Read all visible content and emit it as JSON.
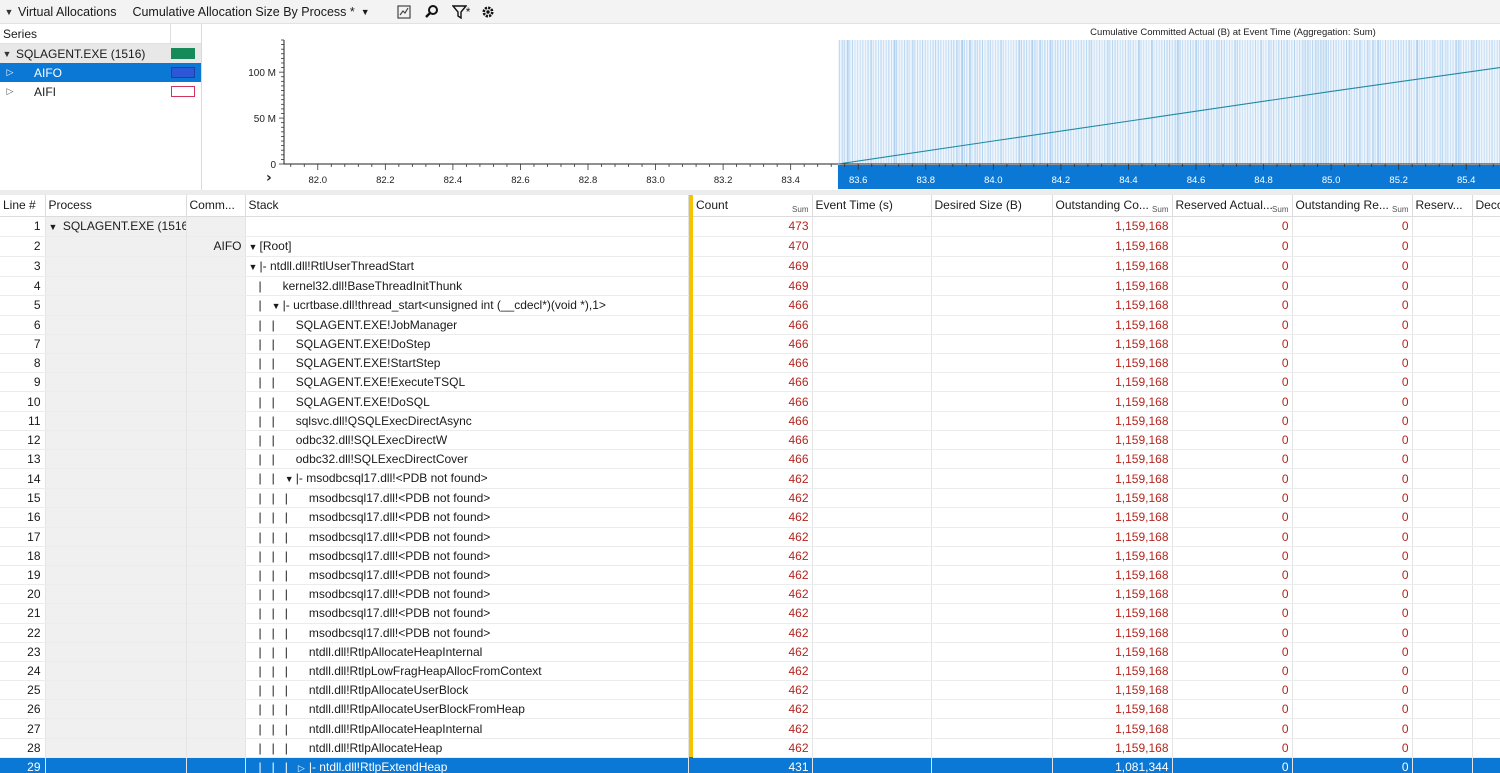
{
  "toolbar": {
    "title": "Virtual Allocations",
    "view_label": "Cumulative Allocation Size By Process *",
    "filter_label": "*"
  },
  "series": {
    "header": "Series",
    "items": [
      {
        "label": "SQLAGENT.EXE (1516)",
        "swatch": "#178a5a",
        "kind": "group",
        "expanded": true
      },
      {
        "label": "AIFO",
        "swatch": "#2c57d6",
        "kind": "child",
        "selected": true
      },
      {
        "label": "AIFI",
        "swatch": "#ffffff",
        "swatch_border": "#d0345a",
        "kind": "child",
        "selected": false
      }
    ]
  },
  "chart_data": {
    "type": "line",
    "title": "Cumulative Committed Actual (B) at Event Time (Aggregation: Sum)",
    "xlim": [
      81.9,
      85.5
    ],
    "ylim": [
      0,
      135
    ],
    "x_ticks": [
      "82.0",
      "82.2",
      "82.4",
      "82.6",
      "82.8",
      "83.0",
      "83.2",
      "83.4",
      "83.6",
      "83.8",
      "84.0",
      "84.2",
      "84.4",
      "84.6",
      "84.8",
      "85.0",
      "85.2",
      "85.4"
    ],
    "x_tick_values": [
      82.0,
      82.2,
      82.4,
      82.6,
      82.8,
      83.0,
      83.2,
      83.4,
      83.6,
      83.8,
      84.0,
      84.2,
      84.4,
      84.6,
      84.8,
      85.0,
      85.2,
      85.4
    ],
    "y_ticks": [
      "0",
      "50 M",
      "100 M"
    ],
    "y_tick_values": [
      0,
      50,
      100
    ],
    "selection_range": [
      83.54,
      85.5
    ],
    "series": [
      {
        "x": [
          83.54,
          84.0,
          84.5,
          85.0,
          85.5
        ],
        "y": [
          0,
          25,
          52,
          79,
          105
        ]
      }
    ],
    "colors": {
      "line": "#1e8aa0",
      "selection": "#0a78d4",
      "event_ticks": "#a8cdee"
    }
  },
  "table": {
    "columns": [
      {
        "label": "Line #"
      },
      {
        "label": "Process"
      },
      {
        "label": "Comm..."
      },
      {
        "label": "Stack"
      },
      {
        "label": "Count",
        "sum": "Sum"
      },
      {
        "label": "Event Time (s)"
      },
      {
        "label": "Desired Size (B)"
      },
      {
        "label": "Outstanding Co...",
        "sum": "Sum"
      },
      {
        "label": "Reserved Actual...",
        "sum": "Sum"
      },
      {
        "label": "Outstanding Re...",
        "sum": "Sum"
      },
      {
        "label": "Reserv..."
      },
      {
        "label": "Deco"
      }
    ],
    "rows": [
      {
        "line": "1",
        "process": "SQLAGENT.EXE (1516)",
        "proc_tri": "▼",
        "comm": "",
        "stack": "",
        "stack_tri": "",
        "pipes": "",
        "count": "473",
        "oc": "1,159,168",
        "ra": "0",
        "or": "0"
      },
      {
        "line": "2",
        "process": "",
        "comm": "AIFO",
        "stack": "[Root]",
        "stack_tri": "▼",
        "pipes": "",
        "count": "470",
        "oc": "1,159,168",
        "ra": "0",
        "or": "0"
      },
      {
        "line": "3",
        "process": "",
        "comm": "",
        "stack": "|- ntdll.dll!RtlUserThreadStart",
        "stack_tri": "▼",
        "pipes": "",
        "count": "469",
        "oc": "1,159,168",
        "ra": "0",
        "or": "0"
      },
      {
        "line": "4",
        "process": "",
        "comm": "",
        "stack": "kernel32.dll!BaseThreadInitThunk",
        "stack_tri": "",
        "pipes": "   |   ",
        "count": "469",
        "oc": "1,159,168",
        "ra": "0",
        "or": "0"
      },
      {
        "line": "5",
        "process": "",
        "comm": "",
        "stack": "|- ucrtbase.dll!thread_start<unsigned int (__cdecl*)(void *),1>",
        "stack_tri": "▼",
        "pipes": "   |   ",
        "count": "466",
        "oc": "1,159,168",
        "ra": "0",
        "or": "0"
      },
      {
        "line": "6",
        "process": "",
        "comm": "",
        "stack": "SQLAGENT.EXE!JobManager",
        "stack_tri": "",
        "pipes": "   |   |   ",
        "count": "466",
        "oc": "1,159,168",
        "ra": "0",
        "or": "0"
      },
      {
        "line": "7",
        "process": "",
        "comm": "",
        "stack": "SQLAGENT.EXE!DoStep",
        "stack_tri": "",
        "pipes": "   |   |   ",
        "count": "466",
        "oc": "1,159,168",
        "ra": "0",
        "or": "0"
      },
      {
        "line": "8",
        "process": "",
        "comm": "",
        "stack": "SQLAGENT.EXE!StartStep",
        "stack_tri": "",
        "pipes": "   |   |   ",
        "count": "466",
        "oc": "1,159,168",
        "ra": "0",
        "or": "0"
      },
      {
        "line": "9",
        "process": "",
        "comm": "",
        "stack": "SQLAGENT.EXE!ExecuteTSQL",
        "stack_tri": "",
        "pipes": "   |   |   ",
        "count": "466",
        "oc": "1,159,168",
        "ra": "0",
        "or": "0"
      },
      {
        "line": "10",
        "process": "",
        "comm": "",
        "stack": "SQLAGENT.EXE!DoSQL",
        "stack_tri": "",
        "pipes": "   |   |   ",
        "count": "466",
        "oc": "1,159,168",
        "ra": "0",
        "or": "0"
      },
      {
        "line": "11",
        "process": "",
        "comm": "",
        "stack": "sqlsvc.dll!QSQLExecDirectAsync",
        "stack_tri": "",
        "pipes": "   |   |   ",
        "count": "466",
        "oc": "1,159,168",
        "ra": "0",
        "or": "0"
      },
      {
        "line": "12",
        "process": "",
        "comm": "",
        "stack": "odbc32.dll!SQLExecDirectW",
        "stack_tri": "",
        "pipes": "   |   |   ",
        "count": "466",
        "oc": "1,159,168",
        "ra": "0",
        "or": "0"
      },
      {
        "line": "13",
        "process": "",
        "comm": "",
        "stack": "odbc32.dll!SQLExecDirectCover",
        "stack_tri": "",
        "pipes": "   |   |   ",
        "count": "466",
        "oc": "1,159,168",
        "ra": "0",
        "or": "0"
      },
      {
        "line": "14",
        "process": "",
        "comm": "",
        "stack": "|- msodbcsql17.dll!<PDB not found>",
        "stack_tri": "▼",
        "pipes": "   |   |   ",
        "count": "462",
        "oc": "1,159,168",
        "ra": "0",
        "or": "0"
      },
      {
        "line": "15",
        "process": "",
        "comm": "",
        "stack": "msodbcsql17.dll!<PDB not found>",
        "stack_tri": "",
        "pipes": "   |   |   |   ",
        "count": "462",
        "oc": "1,159,168",
        "ra": "0",
        "or": "0"
      },
      {
        "line": "16",
        "process": "",
        "comm": "",
        "stack": "msodbcsql17.dll!<PDB not found>",
        "stack_tri": "",
        "pipes": "   |   |   |   ",
        "count": "462",
        "oc": "1,159,168",
        "ra": "0",
        "or": "0"
      },
      {
        "line": "17",
        "process": "",
        "comm": "",
        "stack": "msodbcsql17.dll!<PDB not found>",
        "stack_tri": "",
        "pipes": "   |   |   |   ",
        "count": "462",
        "oc": "1,159,168",
        "ra": "0",
        "or": "0"
      },
      {
        "line": "18",
        "process": "",
        "comm": "",
        "stack": "msodbcsql17.dll!<PDB not found>",
        "stack_tri": "",
        "pipes": "   |   |   |   ",
        "count": "462",
        "oc": "1,159,168",
        "ra": "0",
        "or": "0"
      },
      {
        "line": "19",
        "process": "",
        "comm": "",
        "stack": "msodbcsql17.dll!<PDB not found>",
        "stack_tri": "",
        "pipes": "   |   |   |   ",
        "count": "462",
        "oc": "1,159,168",
        "ra": "0",
        "or": "0"
      },
      {
        "line": "20",
        "process": "",
        "comm": "",
        "stack": "msodbcsql17.dll!<PDB not found>",
        "stack_tri": "",
        "pipes": "   |   |   |   ",
        "count": "462",
        "oc": "1,159,168",
        "ra": "0",
        "or": "0"
      },
      {
        "line": "21",
        "process": "",
        "comm": "",
        "stack": "msodbcsql17.dll!<PDB not found>",
        "stack_tri": "",
        "pipes": "   |   |   |   ",
        "count": "462",
        "oc": "1,159,168",
        "ra": "0",
        "or": "0"
      },
      {
        "line": "22",
        "process": "",
        "comm": "",
        "stack": "msodbcsql17.dll!<PDB not found>",
        "stack_tri": "",
        "pipes": "   |   |   |   ",
        "count": "462",
        "oc": "1,159,168",
        "ra": "0",
        "or": "0"
      },
      {
        "line": "23",
        "process": "",
        "comm": "",
        "stack": "ntdll.dll!RtlpAllocateHeapInternal",
        "stack_tri": "",
        "pipes": "   |   |   |   ",
        "count": "462",
        "oc": "1,159,168",
        "ra": "0",
        "or": "0"
      },
      {
        "line": "24",
        "process": "",
        "comm": "",
        "stack": "ntdll.dll!RtlpLowFragHeapAllocFromContext",
        "stack_tri": "",
        "pipes": "   |   |   |   ",
        "count": "462",
        "oc": "1,159,168",
        "ra": "0",
        "or": "0"
      },
      {
        "line": "25",
        "process": "",
        "comm": "",
        "stack": "ntdll.dll!RtlpAllocateUserBlock",
        "stack_tri": "",
        "pipes": "   |   |   |   ",
        "count": "462",
        "oc": "1,159,168",
        "ra": "0",
        "or": "0"
      },
      {
        "line": "26",
        "process": "",
        "comm": "",
        "stack": "ntdll.dll!RtlpAllocateUserBlockFromHeap",
        "stack_tri": "",
        "pipes": "   |   |   |   ",
        "count": "462",
        "oc": "1,159,168",
        "ra": "0",
        "or": "0"
      },
      {
        "line": "27",
        "process": "",
        "comm": "",
        "stack": "ntdll.dll!RtlpAllocateHeapInternal",
        "stack_tri": "",
        "pipes": "   |   |   |   ",
        "count": "462",
        "oc": "1,159,168",
        "ra": "0",
        "or": "0"
      },
      {
        "line": "28",
        "process": "",
        "comm": "",
        "stack": "ntdll.dll!RtlpAllocateHeap",
        "stack_tri": "",
        "pipes": "   |   |   |   ",
        "count": "462",
        "oc": "1,159,168",
        "ra": "0",
        "or": "0"
      },
      {
        "line": "29",
        "process": "",
        "comm": "",
        "stack": "|- ntdll.dll!RtlpExtendHeap",
        "stack_tri": "▷",
        "pipes": "   |   |   |   ",
        "count": "431",
        "oc": "1,081,344",
        "ra": "0",
        "or": "0",
        "selected": true
      }
    ]
  }
}
